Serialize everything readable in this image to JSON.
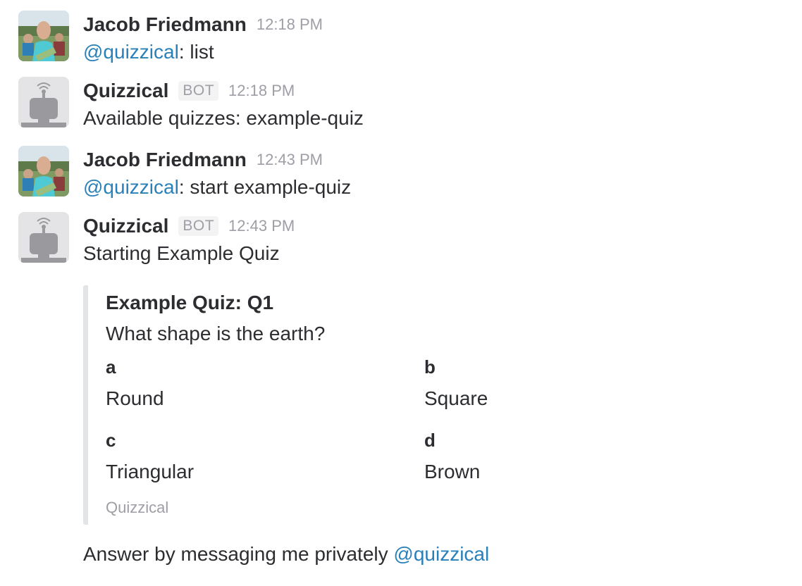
{
  "messages": [
    {
      "author": "Jacob Friedmann",
      "time": "12:18 PM",
      "mention": "@quizzical",
      "text": ": list"
    },
    {
      "author": "Quizzical",
      "badge": "BOT",
      "time": "12:18 PM",
      "text": "Available quizzes: example-quiz"
    },
    {
      "author": "Jacob Friedmann",
      "time": "12:43 PM",
      "mention": "@quizzical",
      "text": ": start example-quiz"
    },
    {
      "author": "Quizzical",
      "badge": "BOT",
      "time": "12:43 PM",
      "text": "Starting Example Quiz"
    }
  ],
  "attachment": {
    "title": "Example Quiz: Q1",
    "text": "What shape is the earth?",
    "fields": [
      {
        "title": "a",
        "value": "Round"
      },
      {
        "title": "b",
        "value": "Square"
      },
      {
        "title": "c",
        "value": "Triangular"
      },
      {
        "title": "d",
        "value": "Brown"
      }
    ],
    "footer": "Quizzical"
  },
  "closing": {
    "text": "Answer by messaging me privately ",
    "mention": "@quizzical"
  },
  "colors": {
    "mention": "#2a80b9",
    "muted": "#9e9ea6",
    "attachment_border": "#e3e4e6"
  },
  "icons": {
    "user_avatar": "user-photo-avatar",
    "bot_avatar": "robot-icon"
  }
}
